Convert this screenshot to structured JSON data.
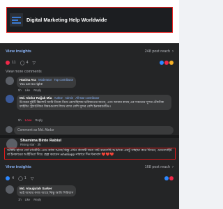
{
  "group_banner": {
    "title": "Digital Marketing Help Worldwide"
  },
  "thread1": {
    "view_insights": "View insights",
    "post_reach": "248 post reach",
    "reactions": {
      "count": "11",
      "comments": "4"
    },
    "view_more": "View more comments",
    "comments": [
      {
        "name": "Hasina Ara",
        "role": "Moderator",
        "badge": "Top contributor",
        "text": "You are so right!",
        "actions": [
          "5h",
          "Like",
          "Reply"
        ]
      },
      {
        "name": "Md. Abdur Rajjak Mia",
        "role": "Author",
        "badge2": "Admin",
        "badge": "All-star contributor",
        "text": "উপরের দুইটি স্ক্রিনশট আমি নিজে নিয়ে রেখেছিলাম ভবিষ্যতের জন্যে, এবং আমার কাছে এর সবচেয়ে সুন্দর টেকনিক ফাইন্ডিং স্ট্র্যাটেজির বিষয়গুলো লিখে রাখা বেশি সুন্দর বেশি ইনফরমেটিভ।",
        "actions": [
          "5h",
          "Love",
          "Reply"
        ]
      }
    ],
    "reply_placeholder": "Comment as Md. Abdur"
  },
  "post2": {
    "author": "Shamima Binte Rabiul",
    "author_sub": "Rising star · 3h",
    "highlighted_text": "আমার হাতে তো মার্কেটিং এবং কাজ আছে কিন্তু এখন প্রজেক্ট জন্য সার্চ করতেছি আমাকে একটু সাহায্য করে দিয়েন, ওয়েবসাইট বা ইনকামের আইডিয়া দিয়ে হেল্প করবেন whatsapp নাম্বারে দিন ধন্যবাদ ❤️❤️❤️",
    "view_insights": "View insights",
    "post_reach": "168 post reach",
    "reactions": {
      "count": "4",
      "comments": "1"
    },
    "comment": {
      "name": "Md. Alaujjulah Sarker",
      "text": "ভাই আমার কাজ আছে কিন্তু আমি সিরিয়াস",
      "actions": [
        "1h",
        "Like",
        "Reply"
      ]
    }
  },
  "colors": {
    "accent": "#e21b1b",
    "link": "#8ab4f8",
    "panel": "#242526"
  }
}
